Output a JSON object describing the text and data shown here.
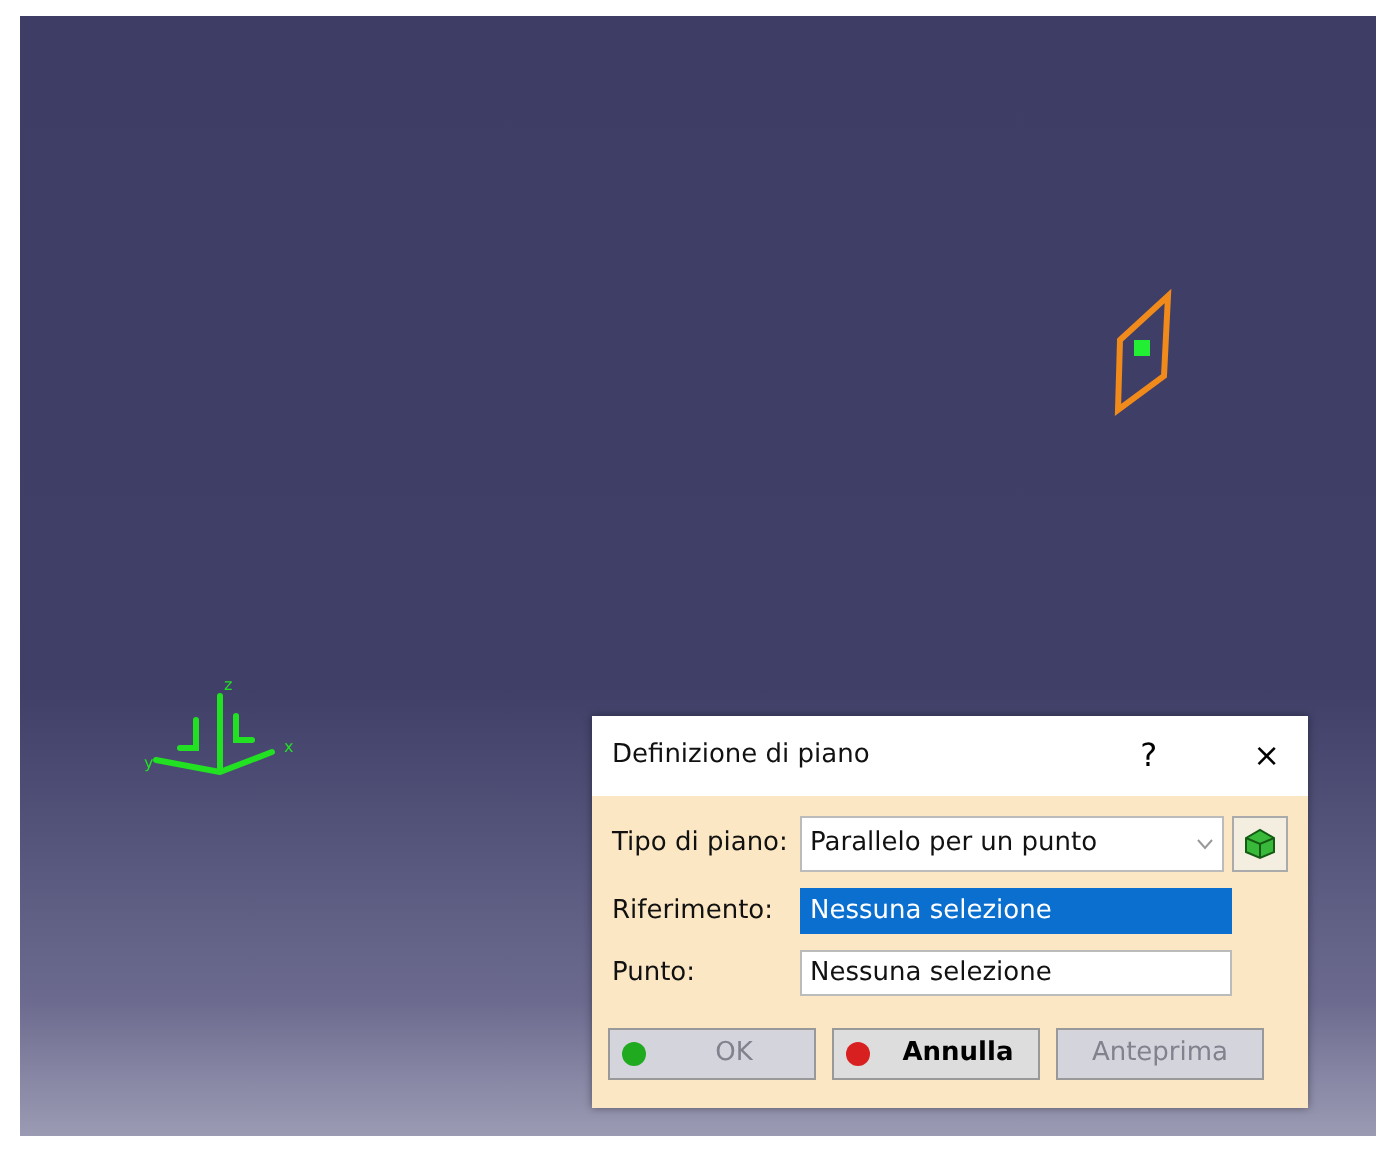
{
  "viewport": {
    "axis_labels": [
      "z",
      "x",
      "y"
    ]
  },
  "dialog": {
    "title": "Definizione di piano",
    "help": "?",
    "close": "×",
    "fields": [
      {
        "label": "Tipo di piano:",
        "kind": "dropdown",
        "value": "Parallelo per un punto",
        "selected": false
      },
      {
        "label": "Riferimento:",
        "kind": "text",
        "value": "Nessuna selezione",
        "selected": true
      },
      {
        "label": "Punto:",
        "kind": "text",
        "value": "Nessuna selezione",
        "selected": false
      }
    ],
    "buttons": [
      {
        "label": "OK",
        "disabled": true,
        "color": "#1faa1f"
      },
      {
        "label": "Annulla",
        "disabled": false,
        "color": "#d82020"
      },
      {
        "label": "Anteprima",
        "disabled": true
      }
    ]
  }
}
